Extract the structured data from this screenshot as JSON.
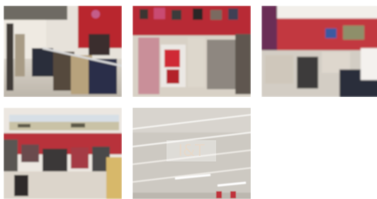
{
  "gallery": {
    "photos": [
      {
        "subject": "store-aisle-with-clothing-racks"
      },
      {
        "subject": "clothing-racks-and-red-wall"
      },
      {
        "subject": "store-interior-red-wall"
      },
      {
        "subject": "store-with-landscape-mural"
      },
      {
        "subject": "store-ceiling-with-logo"
      }
    ],
    "logo_watermark": "I&T"
  },
  "colors": {
    "accent_red": "#c8323f",
    "background": "#ffffff"
  }
}
